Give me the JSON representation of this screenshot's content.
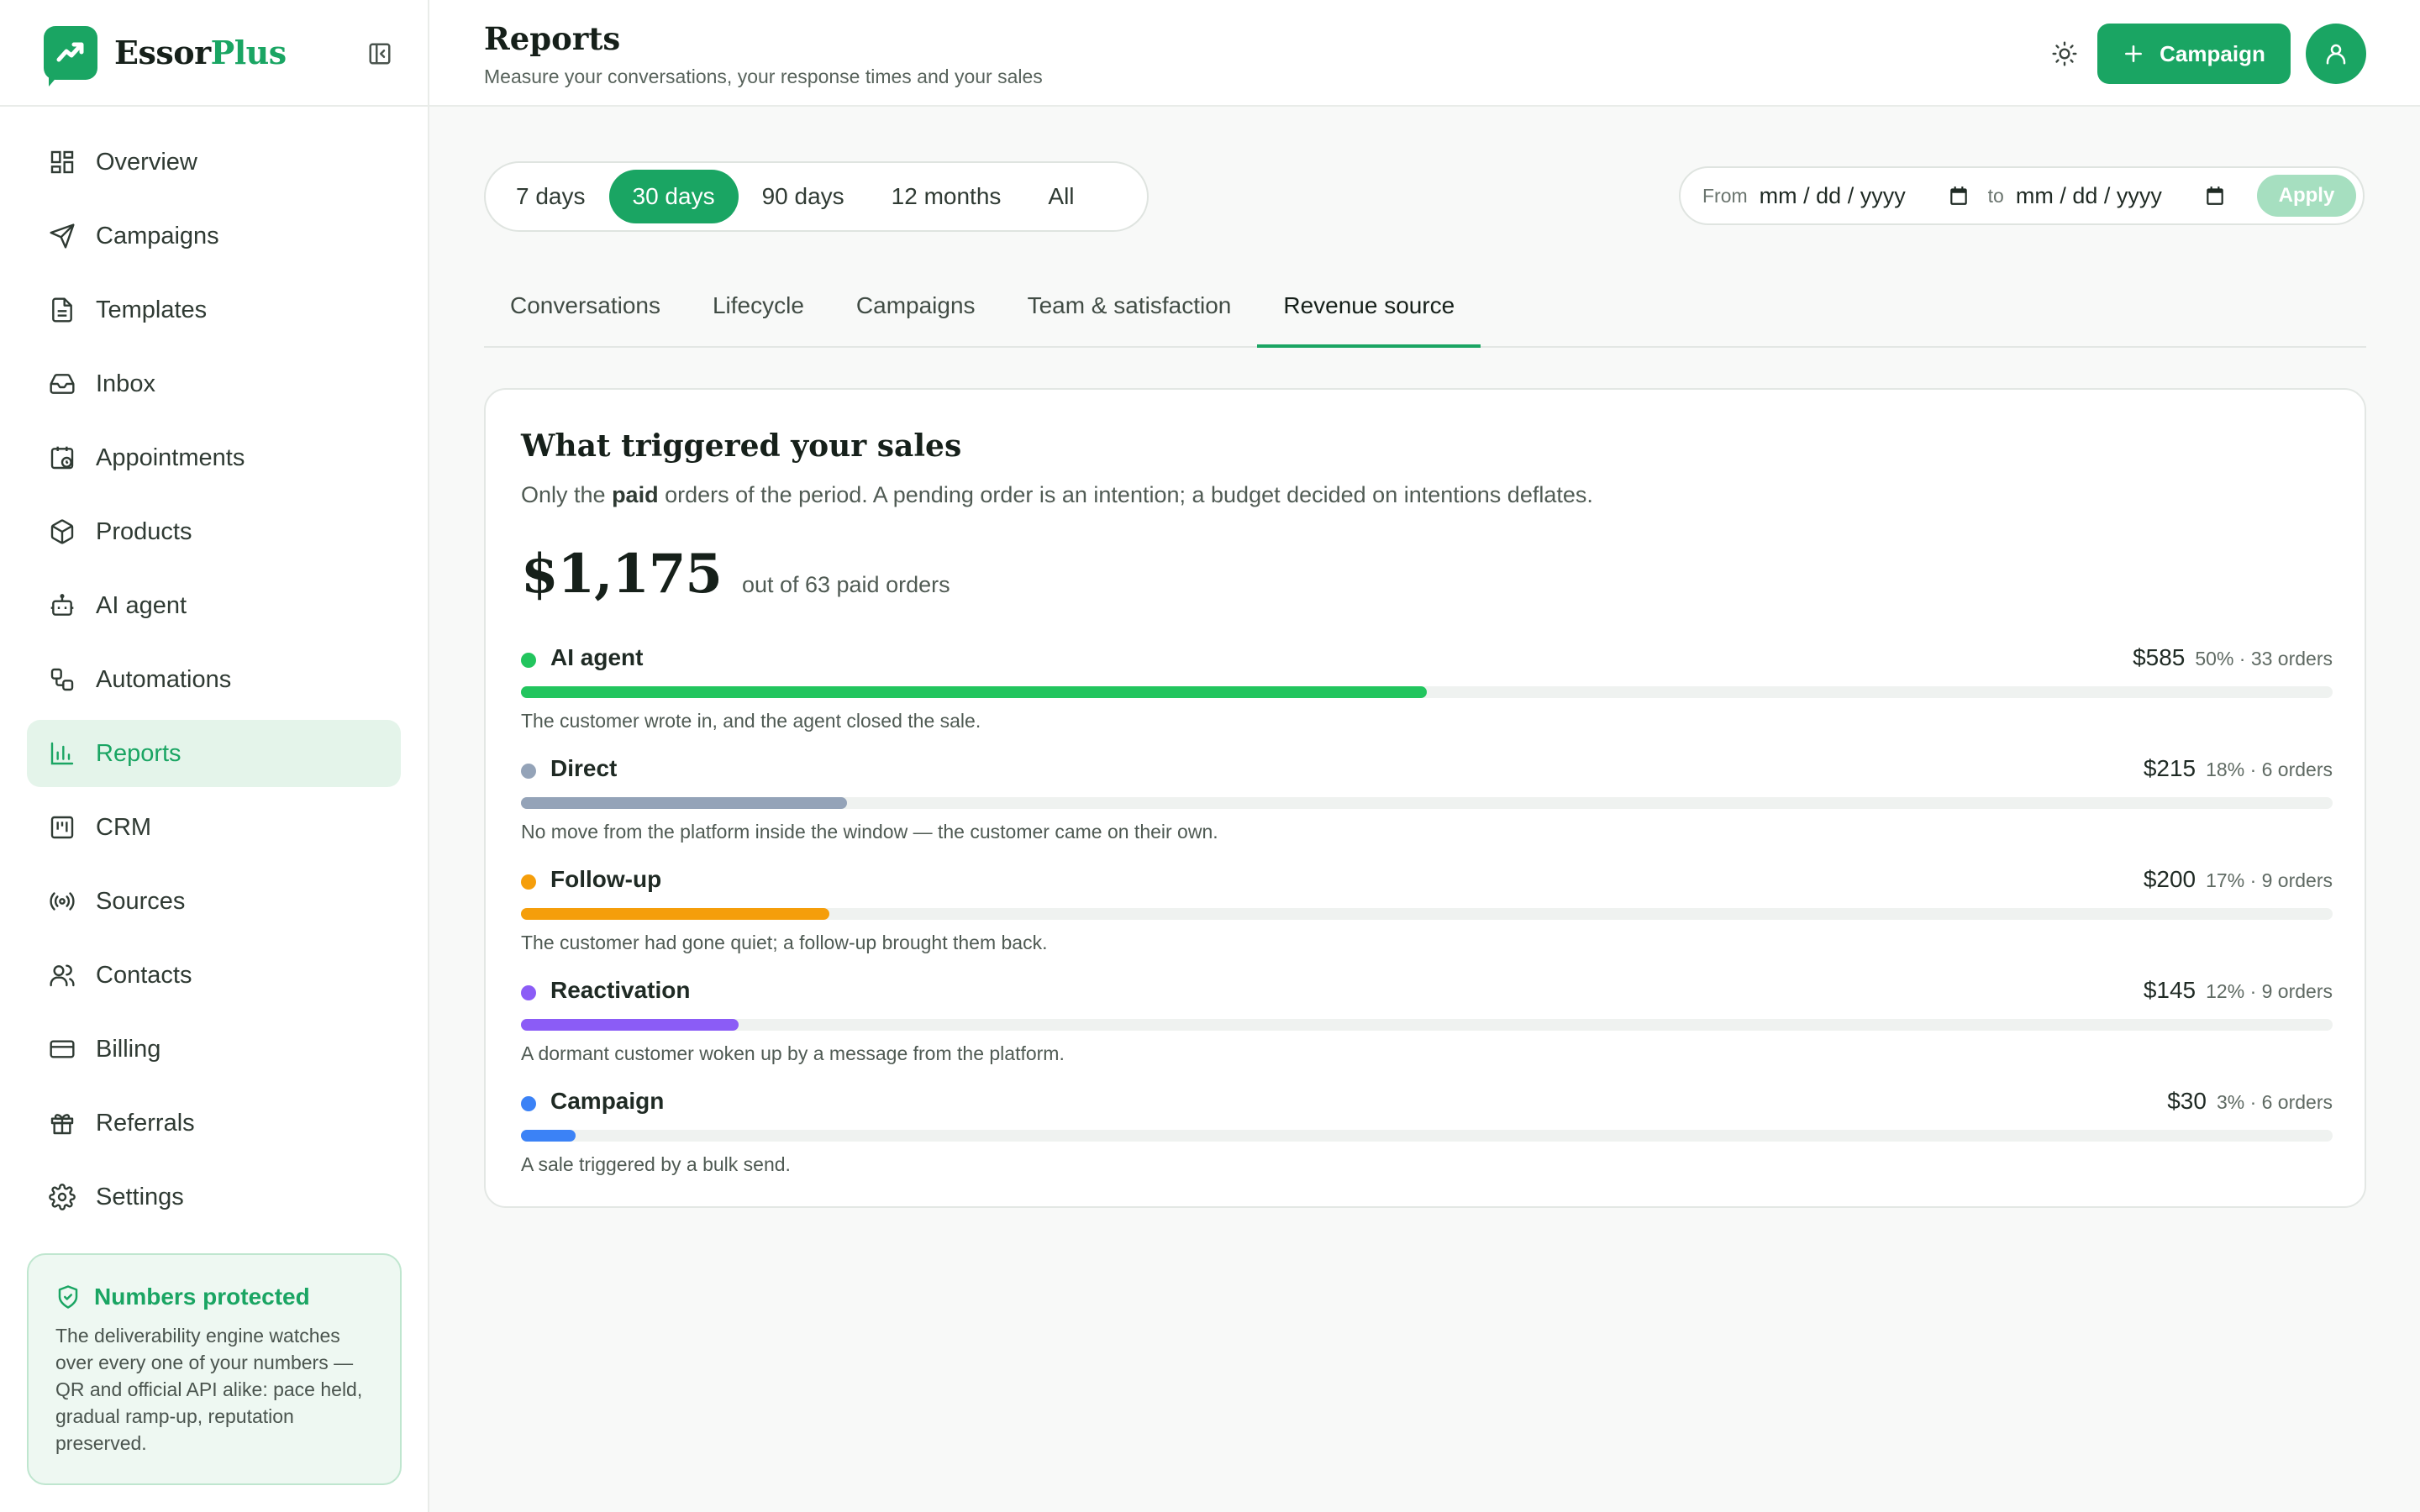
{
  "brand": {
    "name_main": "Essor",
    "name_accent": "Plus",
    "accent_color": "#1aa563"
  },
  "sidebar": {
    "items": [
      {
        "label": "Overview",
        "icon": "grid-icon",
        "active": false
      },
      {
        "label": "Campaigns",
        "icon": "send-icon",
        "active": false
      },
      {
        "label": "Templates",
        "icon": "file-text-icon",
        "active": false
      },
      {
        "label": "Inbox",
        "icon": "inbox-icon",
        "active": false
      },
      {
        "label": "Appointments",
        "icon": "calendar-clock-icon",
        "active": false
      },
      {
        "label": "Products",
        "icon": "package-icon",
        "active": false
      },
      {
        "label": "AI agent",
        "icon": "bot-icon",
        "active": false
      },
      {
        "label": "Automations",
        "icon": "workflow-icon",
        "active": false
      },
      {
        "label": "Reports",
        "icon": "bar-chart-icon",
        "active": true
      },
      {
        "label": "CRM",
        "icon": "kanban-icon",
        "active": false
      },
      {
        "label": "Sources",
        "icon": "radio-icon",
        "active": false
      },
      {
        "label": "Contacts",
        "icon": "users-icon",
        "active": false
      },
      {
        "label": "Billing",
        "icon": "credit-card-icon",
        "active": false
      },
      {
        "label": "Referrals",
        "icon": "gift-icon",
        "active": false
      },
      {
        "label": "Settings",
        "icon": "gear-icon",
        "active": false
      }
    ],
    "protect": {
      "title": "Numbers protected",
      "text": "The deliverability engine watches over every one of your numbers — QR and official API alike: pace held, gradual ramp-up, reputation preserved."
    }
  },
  "header": {
    "title": "Reports",
    "subtitle": "Measure your conversations, your response times and your sales",
    "campaign_button": "Campaign"
  },
  "period": {
    "options": [
      "7 days",
      "30 days",
      "90 days",
      "12 months",
      "All"
    ],
    "selected": "30 days"
  },
  "daterange": {
    "from_label": "From",
    "to_label": "to",
    "from_placeholder": "mm / dd / yyyy",
    "to_placeholder": "mm / dd / yyyy",
    "apply_label": "Apply"
  },
  "tabs": {
    "items": [
      "Conversations",
      "Lifecycle",
      "Campaigns",
      "Team & satisfaction",
      "Revenue source"
    ],
    "active": "Revenue source"
  },
  "card": {
    "title": "What triggered your sales",
    "subtitle_pre": "Only the ",
    "subtitle_bold": "paid",
    "subtitle_post": " orders of the period. A pending order is an intention; a budget decided on intentions deflates.",
    "total": "$1,175",
    "total_note": "out of 63 paid orders"
  },
  "sources": [
    {
      "name": "AI agent",
      "amount": "$585",
      "meta": "50% · 33 orders",
      "share": 0.5,
      "color": "#22c55e",
      "desc": "The customer wrote in, and the agent closed the sale."
    },
    {
      "name": "Direct",
      "amount": "$215",
      "meta": "18% · 6 orders",
      "share": 0.18,
      "color": "#94a3b8",
      "desc": "No move from the platform inside the window — the customer came on their own."
    },
    {
      "name": "Follow-up",
      "amount": "$200",
      "meta": "17% · 9 orders",
      "share": 0.17,
      "color": "#f59e0b",
      "desc": "The customer had gone quiet; a follow-up brought them back."
    },
    {
      "name": "Reactivation",
      "amount": "$145",
      "meta": "12% · 9 orders",
      "share": 0.12,
      "color": "#8b5cf6",
      "desc": "A dormant customer woken up by a message from the platform."
    },
    {
      "name": "Campaign",
      "amount": "$30",
      "meta": "3% · 6 orders",
      "share": 0.03,
      "color": "#3b82f6",
      "desc": "A sale triggered by a bulk send."
    }
  ]
}
